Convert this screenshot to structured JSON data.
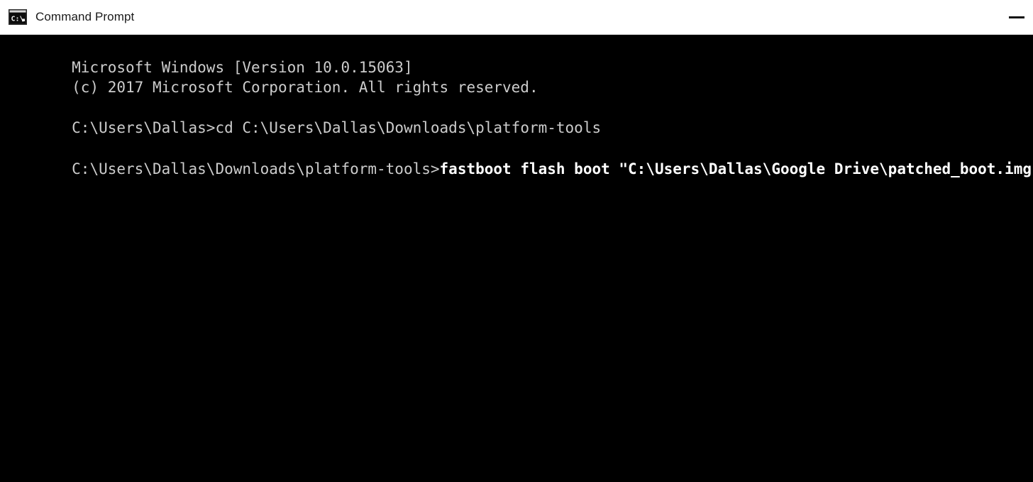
{
  "window": {
    "title": "Command Prompt",
    "icon": "cmd-prompt-icon",
    "background_color": "#000000",
    "titlebar_color": "#ffffff",
    "text_color": "#cccccc",
    "bold_text_color": "#ffffff"
  },
  "titlebar": {
    "minimize_label": "—",
    "minimize_icon": "minimize-icon"
  },
  "console": {
    "lines": [
      {
        "id": "line-version",
        "type": "output",
        "text": "Microsoft Windows [Version 10.0.15063]"
      },
      {
        "id": "line-copyright",
        "type": "output",
        "text": "(c) 2017 Microsoft Corporation. All rights reserved."
      },
      {
        "id": "line-blank-1",
        "type": "blank",
        "text": ""
      },
      {
        "id": "line-cd",
        "type": "prompt",
        "prompt": "C:\\Users\\Dallas>",
        "command": "cd C:\\Users\\Dallas\\Downloads\\platform-tools",
        "bold_command": false,
        "text": "C:\\Users\\Dallas>cd C:\\Users\\Dallas\\Downloads\\platform-tools"
      },
      {
        "id": "line-blank-2",
        "type": "blank",
        "text": ""
      },
      {
        "id": "line-fastboot",
        "type": "prompt",
        "prompt": "C:\\Users\\Dallas\\Downloads\\platform-tools>",
        "command": "fastboot flash boot \"C:\\Users\\Dallas\\Google Drive\\patched_boot.img\"",
        "bold_command": true,
        "text": "C:\\Users\\Dallas\\Downloads\\platform-tools>fastboot flash boot \"C:\\Users\\Dallas\\Google Drive\\patched_boot.img\""
      }
    ]
  }
}
